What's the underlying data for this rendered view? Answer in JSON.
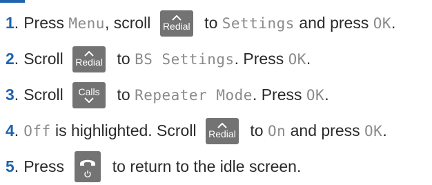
{
  "steps": [
    {
      "number": "1",
      "parts": {
        "a": "Press ",
        "b": "Menu",
        "c": ", scroll ",
        "key": "Redial",
        "d": " to ",
        "e": "Settings",
        "f": " and press ",
        "g": "OK",
        "h": "."
      }
    },
    {
      "number": "2",
      "parts": {
        "a": "Scroll ",
        "key": "Redial",
        "b": " to ",
        "c": "BS Settings",
        "d": ". Press ",
        "e": "OK",
        "f": "."
      }
    },
    {
      "number": "3",
      "parts": {
        "a": "Scroll ",
        "key": "Calls",
        "b": " to ",
        "c": "Repeater Mode",
        "d": ". Press ",
        "e": "OK",
        "f": "."
      }
    },
    {
      "number": "4",
      "parts": {
        "a": "Off",
        "b": " is highlighted. Scroll ",
        "key": "Redial",
        "c": " to ",
        "d": "On",
        "e": " and press ",
        "f": "OK",
        "g": "."
      }
    },
    {
      "number": "5",
      "parts": {
        "a": "Press ",
        "key_icon": "end-call-power-icon",
        "b": " to return to the idle screen."
      }
    }
  ],
  "colors": {
    "accent": "#1f64ad",
    "key_bg": "#737373",
    "lcd_text": "#8a8a8a"
  }
}
